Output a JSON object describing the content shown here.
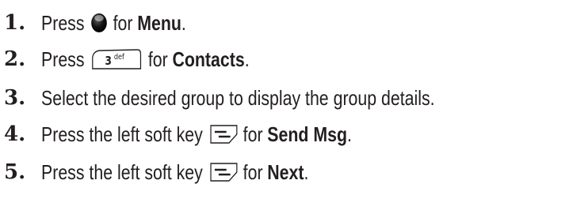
{
  "steps": [
    {
      "number": "1.",
      "before": "Press",
      "icon": "menu-ok-center-key-icon",
      "after": "for",
      "bold": "Menu",
      "end": "."
    },
    {
      "number": "2.",
      "before": "Press",
      "icon": "key-3-def-icon",
      "key_label": "3",
      "key_sub": "def",
      "after": "for",
      "bold": "Contacts",
      "end": "."
    },
    {
      "number": "3.",
      "text": "Select the desired group to display the group details."
    },
    {
      "number": "4.",
      "before": "Press the left soft key",
      "icon": "left-soft-key-icon",
      "after": "for",
      "bold": "Send Msg",
      "end": "."
    },
    {
      "number": "5.",
      "before": "Press the left soft key",
      "icon": "left-soft-key-icon",
      "after": "for",
      "bold": "Next",
      "end": "."
    }
  ],
  "colors": {
    "text": "#231f20"
  }
}
